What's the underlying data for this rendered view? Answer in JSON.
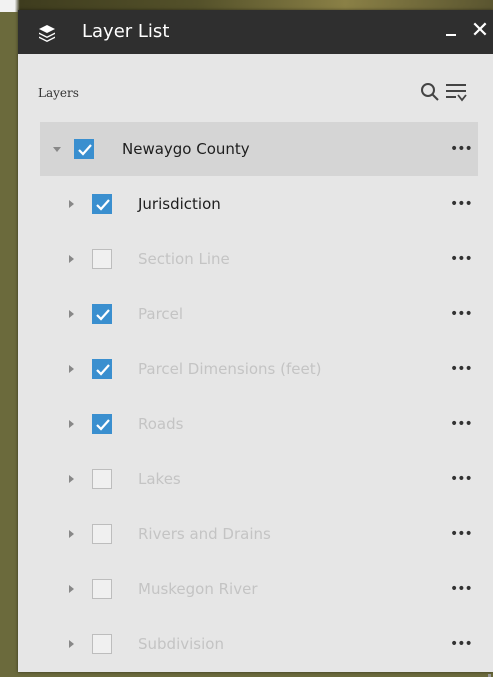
{
  "panel": {
    "title": "Layer List",
    "close": "✕"
  },
  "toolbar": {
    "layers_label": "Layers"
  },
  "colors": {
    "title_bar": "#2f2f2f",
    "panel_bg": "#e6e6e6",
    "group_row": "#d5d5d5",
    "checkbox_checked": "#3a8fcf"
  },
  "group": {
    "label": "Newaygo County",
    "checked": true,
    "expanded": true,
    "visible": true
  },
  "layers": [
    {
      "label": "Jurisdiction",
      "checked": true,
      "visible": true
    },
    {
      "label": "Section Line",
      "checked": false,
      "visible": false
    },
    {
      "label": "Parcel",
      "checked": true,
      "visible": false
    },
    {
      "label": "Parcel Dimensions (feet)",
      "checked": true,
      "visible": false
    },
    {
      "label": "Roads",
      "checked": true,
      "visible": false
    },
    {
      "label": "Lakes",
      "checked": false,
      "visible": false
    },
    {
      "label": "Rivers and Drains",
      "checked": false,
      "visible": false
    },
    {
      "label": "Muskegon River",
      "checked": false,
      "visible": false
    },
    {
      "label": "Subdivision",
      "checked": false,
      "visible": false
    }
  ],
  "more_icon": "•••"
}
